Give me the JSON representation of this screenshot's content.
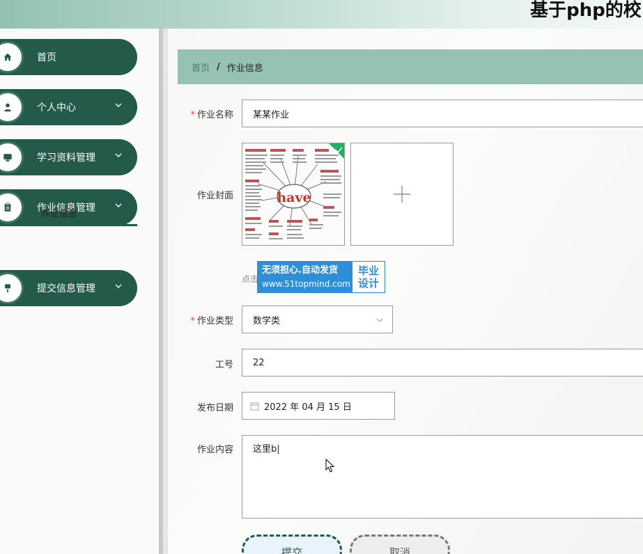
{
  "header": {
    "title": "基于php的校"
  },
  "sidebar": {
    "items": [
      {
        "label": "首页",
        "icon": "home-icon",
        "has_chevron": false
      },
      {
        "label": "个人中心",
        "icon": "user-icon",
        "has_chevron": true
      },
      {
        "label": "学习资料管理",
        "icon": "monitor-icon",
        "has_chevron": true
      },
      {
        "label": "作业信息管理",
        "icon": "clipboard-icon",
        "has_chevron": true
      },
      {
        "label": "提交信息管理",
        "icon": "brush-icon",
        "has_chevron": true
      }
    ],
    "submenu": {
      "label": "作业信息"
    }
  },
  "breadcrumb": {
    "home": "首页",
    "separator": "/",
    "current": "作业信息"
  },
  "form": {
    "name": {
      "label": "作业名称",
      "required": true,
      "value": "某某作业"
    },
    "cover": {
      "label": "作业封面",
      "image_word": "have",
      "tip": "点击"
    },
    "type": {
      "label": "作业类型",
      "required": true,
      "value": "数学类"
    },
    "staff_no": {
      "label": "工号",
      "value": "22"
    },
    "date": {
      "label": "发布日期",
      "value": "2022 年 04 月 15 日"
    },
    "content": {
      "label": "作业内容",
      "value": "这里b|"
    }
  },
  "watermark": {
    "line1": "无须担心.自动发货",
    "line2": "www.51topmind.com",
    "right1": "毕业",
    "right2": "设计"
  },
  "buttons": {
    "submit": "提交",
    "cancel": "取消"
  },
  "colors": {
    "primary": "#245a4a",
    "breadcrumb_bg": "#96c2b3",
    "required": "#e84c3d",
    "check_badge": "#27ae60"
  }
}
